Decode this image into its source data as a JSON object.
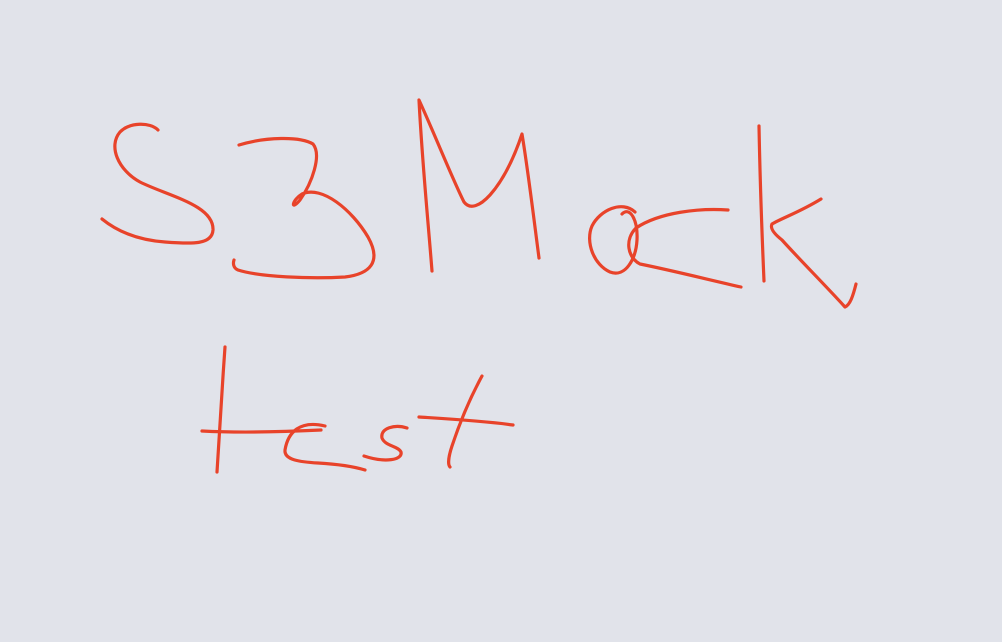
{
  "canvas": {
    "background": "#e1e3ea",
    "ink_color": "#e8432a"
  },
  "handwriting": {
    "line1": "S3Mock",
    "line2": "test"
  }
}
